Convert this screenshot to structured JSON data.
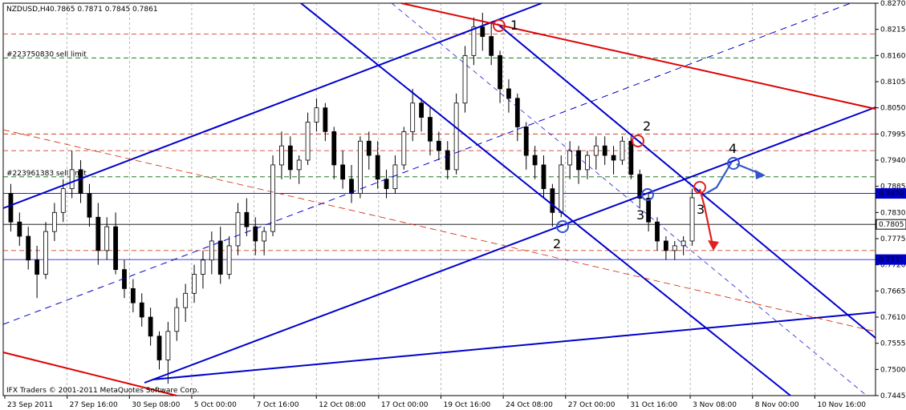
{
  "header": {
    "symbol": "NZDUSD,H4",
    "quotes": "0.7865 0.7871 0.7845 0.7861"
  },
  "orders": [
    {
      "label": "#223750830 sell limit",
      "price": 0.8155
    },
    {
      "label": "#223961383 sell limit",
      "price": 0.7905
    }
  ],
  "footer": {
    "copyright": "IFX Traders © 2001-2011 MetaQuotes Software Corp."
  },
  "colors": {
    "candle": "#000000",
    "blue_line": "#0000cc",
    "red_line": "#dd0000",
    "red_dash": "#cc2200",
    "green_dash": "#006600",
    "marker_red": "#e02020",
    "marker_blue": "#3355cc",
    "price_box": "#0000cc"
  },
  "chart_data": {
    "type": "candlestick",
    "title": "NZDUSD,H4",
    "ylim": [
      0.7445,
      0.827
    ],
    "y_ticks": [
      0.827,
      0.8215,
      0.816,
      0.8105,
      0.805,
      0.7995,
      0.794,
      0.7885,
      0.783,
      0.7775,
      0.772,
      0.7665,
      0.761,
      0.7555,
      0.75,
      0.7445
    ],
    "x_ticks": [
      "23 Sep 2011",
      "27 Sep 16:00",
      "30 Sep 08:00",
      "5 Oct 00:00",
      "7 Oct 16:00",
      "12 Oct 08:00",
      "17 Oct 00:00",
      "19 Oct 16:00",
      "24 Oct 08:00",
      "27 Oct 00:00",
      "31 Oct 16:00",
      "3 Nov 08:00",
      "8 Nov 00:00",
      "10 Nov 16:00"
    ],
    "price_labels": [
      {
        "value": "0.7870",
        "price": 0.787
      },
      {
        "value": "0.7805",
        "price": 0.7805
      },
      {
        "value": "0.7731",
        "price": 0.7731
      }
    ],
    "series": [
      {
        "values": [
          [
            0.787,
            0.789,
            0.779,
            0.781
          ],
          [
            0.781,
            0.783,
            0.776,
            0.778
          ],
          [
            0.778,
            0.78,
            0.771,
            0.773
          ],
          [
            0.773,
            0.776,
            0.765,
            0.77
          ],
          [
            0.77,
            0.781,
            0.769,
            0.779
          ],
          [
            0.779,
            0.785,
            0.777,
            0.783
          ],
          [
            0.783,
            0.79,
            0.781,
            0.788
          ],
          [
            0.788,
            0.796,
            0.786,
            0.792
          ],
          [
            0.792,
            0.794,
            0.785,
            0.787
          ],
          [
            0.787,
            0.789,
            0.78,
            0.782
          ],
          [
            0.782,
            0.785,
            0.772,
            0.775
          ],
          [
            0.775,
            0.782,
            0.773,
            0.78
          ],
          [
            0.78,
            0.783,
            0.77,
            0.771
          ],
          [
            0.771,
            0.773,
            0.765,
            0.767
          ],
          [
            0.767,
            0.769,
            0.762,
            0.764
          ],
          [
            0.764,
            0.766,
            0.759,
            0.761
          ],
          [
            0.761,
            0.763,
            0.755,
            0.757
          ],
          [
            0.757,
            0.758,
            0.75,
            0.752
          ],
          [
            0.752,
            0.76,
            0.747,
            0.758
          ],
          [
            0.758,
            0.765,
            0.756,
            0.763
          ],
          [
            0.763,
            0.768,
            0.76,
            0.766
          ],
          [
            0.766,
            0.772,
            0.764,
            0.77
          ],
          [
            0.77,
            0.775,
            0.767,
            0.773
          ],
          [
            0.773,
            0.779,
            0.77,
            0.777
          ],
          [
            0.777,
            0.78,
            0.768,
            0.77
          ],
          [
            0.77,
            0.778,
            0.769,
            0.776
          ],
          [
            0.776,
            0.785,
            0.774,
            0.783
          ],
          [
            0.783,
            0.786,
            0.778,
            0.78
          ],
          [
            0.78,
            0.782,
            0.774,
            0.777
          ],
          [
            0.777,
            0.78,
            0.774,
            0.779
          ],
          [
            0.779,
            0.795,
            0.778,
            0.793
          ],
          [
            0.793,
            0.8,
            0.79,
            0.797
          ],
          [
            0.797,
            0.799,
            0.79,
            0.792
          ],
          [
            0.792,
            0.795,
            0.789,
            0.794
          ],
          [
            0.794,
            0.804,
            0.793,
            0.802
          ],
          [
            0.802,
            0.807,
            0.8,
            0.805
          ],
          [
            0.805,
            0.806,
            0.798,
            0.8
          ],
          [
            0.8,
            0.801,
            0.79,
            0.793
          ],
          [
            0.793,
            0.796,
            0.788,
            0.79
          ],
          [
            0.79,
            0.793,
            0.785,
            0.787
          ],
          [
            0.787,
            0.799,
            0.786,
            0.798
          ],
          [
            0.798,
            0.8,
            0.792,
            0.795
          ],
          [
            0.795,
            0.798,
            0.788,
            0.79
          ],
          [
            0.79,
            0.792,
            0.786,
            0.788
          ],
          [
            0.788,
            0.795,
            0.787,
            0.793
          ],
          [
            0.793,
            0.801,
            0.792,
            0.8
          ],
          [
            0.8,
            0.809,
            0.798,
            0.806
          ],
          [
            0.806,
            0.807,
            0.8,
            0.803
          ],
          [
            0.803,
            0.805,
            0.795,
            0.798
          ],
          [
            0.798,
            0.8,
            0.794,
            0.796
          ],
          [
            0.796,
            0.798,
            0.79,
            0.792
          ],
          [
            0.792,
            0.808,
            0.791,
            0.806
          ],
          [
            0.806,
            0.818,
            0.804,
            0.816
          ],
          [
            0.816,
            0.824,
            0.814,
            0.822
          ],
          [
            0.822,
            0.825,
            0.817,
            0.82
          ],
          [
            0.82,
            0.823,
            0.814,
            0.816
          ],
          [
            0.816,
            0.817,
            0.806,
            0.809
          ],
          [
            0.809,
            0.811,
            0.804,
            0.807
          ],
          [
            0.807,
            0.808,
            0.798,
            0.801
          ],
          [
            0.801,
            0.802,
            0.792,
            0.795
          ],
          [
            0.795,
            0.797,
            0.79,
            0.793
          ],
          [
            0.793,
            0.795,
            0.786,
            0.788
          ],
          [
            0.788,
            0.789,
            0.78,
            0.783
          ],
          [
            0.783,
            0.795,
            0.782,
            0.793
          ],
          [
            0.793,
            0.798,
            0.79,
            0.796
          ],
          [
            0.796,
            0.797,
            0.789,
            0.792
          ],
          [
            0.792,
            0.796,
            0.79,
            0.795
          ],
          [
            0.795,
            0.799,
            0.792,
            0.797
          ],
          [
            0.797,
            0.799,
            0.793,
            0.795
          ],
          [
            0.795,
            0.797,
            0.791,
            0.794
          ],
          [
            0.794,
            0.799,
            0.793,
            0.798
          ],
          [
            0.798,
            0.799,
            0.79,
            0.791
          ],
          [
            0.791,
            0.792,
            0.784,
            0.786
          ],
          [
            0.786,
            0.787,
            0.779,
            0.781
          ],
          [
            0.781,
            0.782,
            0.775,
            0.777
          ],
          [
            0.777,
            0.778,
            0.773,
            0.775
          ],
          [
            0.775,
            0.777,
            0.773,
            0.776
          ],
          [
            0.776,
            0.778,
            0.774,
            0.777
          ],
          [
            0.777,
            0.788,
            0.776,
            0.7861
          ]
        ]
      }
    ],
    "annotations": [
      {
        "text": "1",
        "color": "red"
      },
      {
        "text": "2",
        "color": "red"
      },
      {
        "text": "3",
        "color": "red"
      },
      {
        "text": "2",
        "color": "blue"
      },
      {
        "text": "3",
        "color": "blue"
      },
      {
        "text": "4",
        "color": "blue"
      }
    ]
  }
}
